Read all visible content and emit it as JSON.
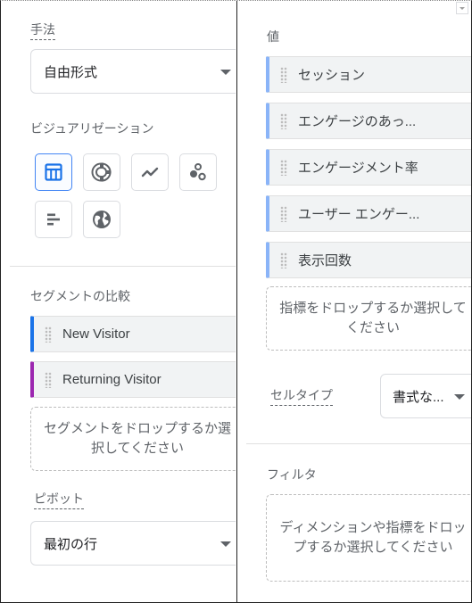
{
  "left": {
    "method_label": "手法",
    "method_value": "自由形式",
    "visualization_label": "ビジュアリゼーション",
    "visualizations": [
      {
        "name": "table",
        "active": true
      },
      {
        "name": "donut-chart",
        "active": false
      },
      {
        "name": "line-chart",
        "active": false
      },
      {
        "name": "scatter-plot",
        "active": false
      },
      {
        "name": "bar-chart",
        "active": false
      },
      {
        "name": "geo-map",
        "active": false
      }
    ],
    "segment_compare_label": "セグメントの比較",
    "segments": [
      {
        "label": "New Visitor",
        "color": "#1a73e8"
      },
      {
        "label": "Returning Visitor",
        "color": "#9c27b0"
      }
    ],
    "segment_drop_text": "セグメントをドロップするか選択してください",
    "pivot_label": "ピボット",
    "pivot_value": "最初の行"
  },
  "right": {
    "values_label": "値",
    "values": [
      {
        "label": "セッション"
      },
      {
        "label": "エンゲージのあっ..."
      },
      {
        "label": "エンゲージメント率"
      },
      {
        "label": "ユーザー エンゲー..."
      },
      {
        "label": "表示回数"
      }
    ],
    "metric_drop_text": "指標をドロップするか選択してください",
    "cell_type_label": "セルタイプ",
    "cell_type_value": "書式な...",
    "filter_label": "フィルタ",
    "filter_drop_text": "ディメンションや指標をドロップするか選択してください"
  },
  "colors": {
    "accent": "#1a73e8",
    "value_chip_accent": "#8ab4f8",
    "segment_new": "#1a73e8",
    "segment_returning": "#9c27b0"
  }
}
